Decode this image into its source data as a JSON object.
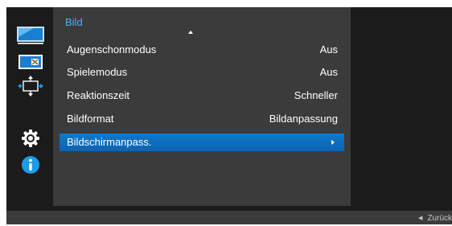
{
  "menu": {
    "title": "Bild",
    "items": [
      {
        "label": "Augenschonmodus",
        "value": "Aus"
      },
      {
        "label": "Spielemodus",
        "value": "Aus"
      },
      {
        "label": "Reaktionszeit",
        "value": "Schneller"
      },
      {
        "label": "Bildformat",
        "value": "Bildanpassung"
      },
      {
        "label": "Bildschirmanpass.",
        "value": ""
      }
    ],
    "selected_index": 4
  },
  "sidebar": {
    "icons": [
      "monitor-icon",
      "color-icon",
      "resize-arrows-icon",
      "gear-icon",
      "info-icon"
    ]
  },
  "footer": {
    "back_label": "Zurück"
  },
  "colors": {
    "title_accent": "#48b3ec",
    "selection": "#0f6fbf",
    "panel": "#3b3b3b",
    "background": "#1b1b1b"
  }
}
